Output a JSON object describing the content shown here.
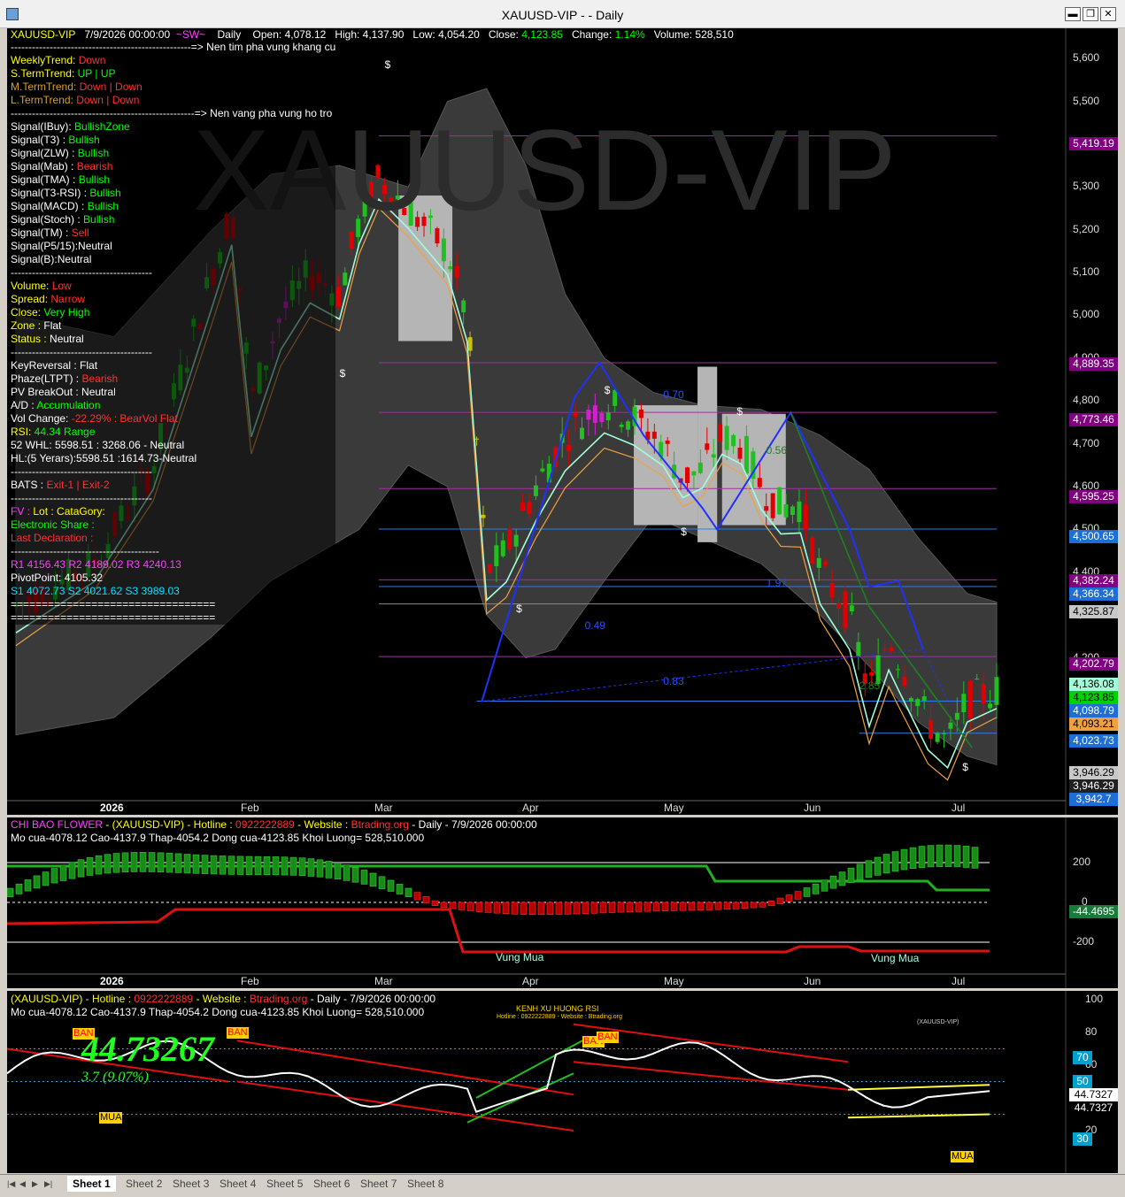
{
  "window": {
    "title": "XAUUSD-VIP -  - Daily",
    "min": "▬",
    "restore": "❐",
    "close": "✕"
  },
  "header": {
    "symbol": "XAUUSD-VIP",
    "date": "7/9/2026 00:00:00",
    "tag": "~SW~",
    "period": "Daily",
    "open_label": "Open:",
    "open": "4,078.12",
    "high_label": "High:",
    "high": "4,137.90",
    "low_label": "Low:",
    "low": "4,054.20",
    "close_label": "Close:",
    "close": "4,123.85",
    "change_label": "Change:",
    "change": "1.14%",
    "volume_label": "Volume:",
    "volume": "528,510"
  },
  "watermark": "XAUUSD-VIP",
  "indicators": [
    {
      "text": "---------------------------------------------------=> Nen tim pha vung khang cu",
      "color": "#ffffff"
    },
    {
      "text": "WeeklyTrend: Down",
      "color": "#ff3030",
      "label": "WeeklyTrend: ",
      "lcolor": "#ffff00",
      "value": "Down"
    },
    {
      "label": "S.TermTrend: ",
      "lcolor": "#ffff00",
      "value": "UP | UP",
      "color": "#00ff00"
    },
    {
      "label": "M.TermTrend: ",
      "lcolor": "#d8a020",
      "value": "Down | Down",
      "color": "#ff3030"
    },
    {
      "label": "L.TermTrend: ",
      "lcolor": "#d8a020",
      "value": "Down | Down",
      "color": "#ff3030"
    },
    {
      "text": "----------------------------------------------------=> Nen vang pha vung ho tro",
      "color": "#ffffff"
    },
    {
      "label": "Signal(IBuy): ",
      "lcolor": "#ffffff",
      "value": "BullishZone",
      "color": "#00ff00"
    },
    {
      "label": "Signal(T3)    : ",
      "lcolor": "#ffffff",
      "value": "Bullish",
      "color": "#00ff00"
    },
    {
      "label": "Signal(ZLW)  : ",
      "lcolor": "#ffffff",
      "value": "Bullish",
      "color": "#00ff00"
    },
    {
      "label": "Signal(Mab)  : ",
      "lcolor": "#ffffff",
      "value": "Bearish",
      "color": "#ff3030"
    },
    {
      "label": "Signal(TMA)  : ",
      "lcolor": "#ffffff",
      "value": "Bullish",
      "color": "#00ff00"
    },
    {
      "label": "Signal(T3-RSI) : ",
      "lcolor": "#ffffff",
      "value": "Bullish",
      "color": "#00ff00"
    },
    {
      "label": "Signal(MACD) : ",
      "lcolor": "#ffffff",
      "value": "Bullish",
      "color": "#00ff00"
    },
    {
      "label": "Signal(Stoch) : ",
      "lcolor": "#ffffff",
      "value": "Bullish",
      "color": "#00ff00"
    },
    {
      "label": "Signal(TM) : ",
      "lcolor": "#ffffff",
      "value": "Sell",
      "color": "#ff3030"
    },
    {
      "label": "Signal(P5/15):",
      "lcolor": "#ffffff",
      "value": "Neutral",
      "color": "#ffffff"
    },
    {
      "label": "Signal(B):",
      "lcolor": "#ffffff",
      "value": "Neutral",
      "color": "#ffffff"
    },
    {
      "text": "----------------------------------------",
      "color": "#ffffff"
    },
    {
      "label": "Volume: ",
      "lcolor": "#ffff00",
      "value": "Low",
      "color": "#ff3030"
    },
    {
      "label": "Spread: ",
      "lcolor": "#ffff00",
      "value": " Narrow",
      "color": "#ff3030"
    },
    {
      "label": "Close: ",
      "lcolor": "#ffff00",
      "value": "Very High",
      "color": "#00ff00"
    },
    {
      "label": "Zone : ",
      "lcolor": "#ffff00",
      "value": "Flat",
      "color": "#ffffff"
    },
    {
      "label": "Status : ",
      "lcolor": "#ffff00",
      "value": "Neutral",
      "color": "#ffffff"
    },
    {
      "text": "----------------------------------------",
      "color": "#ffffff"
    },
    {
      "label": "KeyReversal : ",
      "lcolor": "#ffffff",
      "value": "Flat",
      "color": "#ffffff"
    },
    {
      "label": "Phaze(LTPT) : ",
      "lcolor": "#ffffff",
      "value": "Bearish",
      "color": "#ff3030"
    },
    {
      "label": "PV BreakOut : ",
      "lcolor": "#ffffff",
      "value": "Neutral",
      "color": "#ffffff"
    },
    {
      "label": "A/D : ",
      "lcolor": "#ffffff",
      "value": "Accumulation",
      "color": "#00ff00"
    },
    {
      "label": "Vol Change: ",
      "lcolor": "#ffffff",
      "value": "-22.29% : BearVol Flat",
      "color": "#ff3030"
    },
    {
      "label": "RSI: ",
      "lcolor": "#ffff00",
      "value": "44.34  Range",
      "color": "#00ff00"
    },
    {
      "label": "52 WHL: ",
      "lcolor": "#ffffff",
      "value": "5598.51 : 3268.06 - Neutral",
      "color": "#ffffff"
    },
    {
      "label": "HL:(5 Yerars):",
      "lcolor": "#ffffff",
      "value": "5598.51 :1614.73-Neutral",
      "color": "#ffffff"
    },
    {
      "text": "----------------------------------------",
      "color": "#ffffff"
    },
    {
      "label": "BATS : ",
      "lcolor": "#ffffff",
      "value": "Exit-1 | Exit-2",
      "color": "#ff3030"
    },
    {
      "text": "----------------------------------------",
      "color": "#ffffff"
    },
    {
      "label": "FV : ",
      "lcolor": "#ff40ff",
      "value": " Lot :   CataGory:",
      "color": "#ffff00"
    },
    {
      "label": "Electronic Share :",
      "lcolor": "#00ff00",
      "value": "",
      "color": "#00ff00"
    },
    {
      "label": "Last Declaration :",
      "lcolor": "#ff3030",
      "value": "",
      "color": "#ff3030"
    },
    {
      "text": "------------------------------------------",
      "color": "#ffffff"
    },
    {
      "label": "R1 4156.43 R2 4189.02 R3 4240.13",
      "lcolor": "#ff40ff",
      "value": "",
      "color": "#ff40ff"
    },
    {
      "label": "PivotPoint: 4105.32",
      "lcolor": "#ffffff",
      "value": "",
      "color": "#ffffff"
    },
    {
      "label": "S1 4072.73 S2 4021.62 S3 3989.03",
      "lcolor": "#00e0ff",
      "value": "",
      "color": "#00e0ff"
    },
    {
      "text": "=================================",
      "color": "#ffffff"
    },
    {
      "text": "=================================",
      "color": "#ffffff"
    }
  ],
  "price_axis": [
    "5,600",
    "5,500",
    "5,400",
    "5,300",
    "5,200",
    "5,100",
    "5,000",
    "4,900",
    "4,800",
    "4,700",
    "4,600",
    "4,500",
    "4,400",
    "4,300",
    "4,200",
    "4,100",
    "4,000"
  ],
  "price_tags": [
    {
      "text": "5,419.19",
      "bg": "#800080",
      "fg": "#ffffff",
      "y": 5419.19
    },
    {
      "text": "4,889.35",
      "bg": "#800080",
      "fg": "#ffffff",
      "y": 4889.35
    },
    {
      "text": "4,773.46",
      "bg": "#800080",
      "fg": "#ffffff",
      "y": 4773.46
    },
    {
      "text": "4,595.25",
      "bg": "#800080",
      "fg": "#ffffff",
      "y": 4595.25
    },
    {
      "text": "4,500.65",
      "bg": "#1e6ed8",
      "fg": "#ffffff",
      "y": 4500.65
    },
    {
      "text": "4,382.24",
      "bg": "#800080",
      "fg": "#ffffff",
      "y": 4382.24
    },
    {
      "text": "4,366.34",
      "bg": "#1e6ed8",
      "fg": "#ffffff",
      "y": 4366.34
    },
    {
      "text": "4,325.87",
      "bg": "#c8c8c8",
      "fg": "#000000",
      "y": 4325.87
    },
    {
      "text": "4,202.79",
      "bg": "#800080",
      "fg": "#ffffff",
      "y": 4202.79
    },
    {
      "text": "4,136.08",
      "bg": "#a0ffd8",
      "fg": "#000000",
      "y": 4136.08
    },
    {
      "text": "4,123.85",
      "bg": "#00d000",
      "fg": "#000000",
      "y": 4123.85
    },
    {
      "text": "4,098.79",
      "bg": "#1e6ed8",
      "fg": "#ffffff",
      "y": 4098.79
    },
    {
      "text": "4,093.21",
      "bg": "#f0a040",
      "fg": "#000000",
      "y": 4093.21
    },
    {
      "text": "4,023.73",
      "bg": "#1e6ed8",
      "fg": "#ffffff",
      "y": 4023.73
    },
    {
      "text": "3,946.29",
      "bg": "#c8c8c8",
      "fg": "#000000",
      "y": 3946.29
    },
    {
      "text": "3,946.29",
      "bg": "#202020",
      "fg": "#ffffff",
      "y": 3946.29
    },
    {
      "text": "3,942.7",
      "bg": "#1e6ed8",
      "fg": "#ffffff",
      "y": 3942.7
    }
  ],
  "months": [
    {
      "label": "2026",
      "bold": true
    },
    {
      "label": "Feb"
    },
    {
      "label": "Mar"
    },
    {
      "label": "Apr"
    },
    {
      "label": "May"
    },
    {
      "label": "Jun"
    },
    {
      "label": "Jul"
    }
  ],
  "fib_labels": [
    "0.70",
    "0.56",
    "1.97",
    "0.49",
    "0.83",
    "2.85"
  ],
  "dollar_sign": "$",
  "pane2": {
    "title": "CHI BAO FLOWER",
    "title_rest": " - (XAUUSD-VIP) - Hotline : ",
    "hotline": "0922222889",
    "website_label": " - Website : ",
    "website": "Btrading.org",
    "tail": " - Daily  - 7/9/2026 00:00:00",
    "ohlc": "Mo cua-4078.12  Cao-4137.9  Thap-4054.2  Dong cua-4123.85  Khoi Luong= 528,510.000",
    "axis": [
      "200",
      "0",
      "-200"
    ],
    "value_tag": "-44.4695",
    "zone_labels": [
      "Vung Mua",
      "Vung Mua"
    ]
  },
  "pane3": {
    "title": "(XAUUSD-VIP) - Hotline : ",
    "hotline": "0922222889",
    "website_label": " - Website : ",
    "website": "Btrading.org",
    "tail": " - Daily - 7/9/2026 00:00:00",
    "ohlc": "Mo cua-4078.12  Cao-4137.9  Thap-4054.2  Dong cua-4123.85  Khoi Luong= 528,510.000",
    "center_title": "KENH XU HUONG RSI",
    "center_sub": "Hotline : 0922222889 - Website : Btrading.org",
    "small_tag": "(XAUUSD-VIP)",
    "big_value": "44.73267",
    "big_change": "3.7 (9.07%)",
    "axis": [
      "100",
      "80",
      "60",
      "40",
      "20"
    ],
    "level_tags": [
      "70",
      "50",
      "30"
    ],
    "value_tags": [
      "44.7327",
      "44.7327"
    ],
    "signal_labels": {
      "ban": "BAN",
      "mua": "MUA"
    }
  },
  "tabs": [
    "Sheet 1",
    "Sheet 2",
    "Sheet 3",
    "Sheet 4",
    "Sheet 5",
    "Sheet 6",
    "Sheet 7",
    "Sheet 8"
  ],
  "nav": [
    "|◀",
    "◀",
    "▶",
    "▶|"
  ],
  "colors": {
    "bull": "#00c800",
    "bear": "#e00000",
    "accent": "#00ff00"
  }
}
